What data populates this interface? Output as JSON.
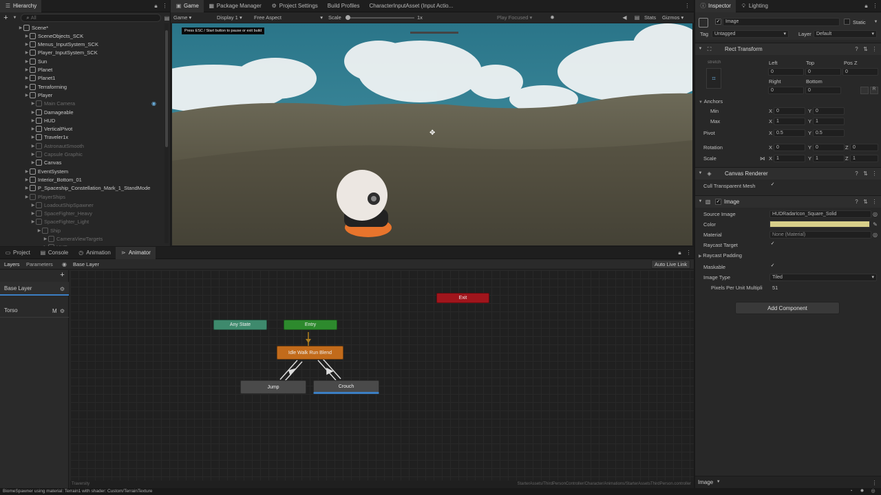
{
  "hierarchy": {
    "tab": "Hierarchy",
    "search_placeholder": "All",
    "items": [
      {
        "label": "Scene*",
        "indent": 0,
        "dim": false
      },
      {
        "label": "SceneObjects_SCK",
        "indent": 1,
        "dim": false
      },
      {
        "label": "Menus_InputSystem_SCK",
        "indent": 1,
        "dim": false
      },
      {
        "label": "Player_InputSystem_SCK",
        "indent": 1,
        "dim": false
      },
      {
        "label": "Sun",
        "indent": 1,
        "dim": false
      },
      {
        "label": "Planet",
        "indent": 1,
        "dim": false
      },
      {
        "label": "Planet1",
        "indent": 1,
        "dim": false
      },
      {
        "label": "Terraforming",
        "indent": 1,
        "dim": false
      },
      {
        "label": "Player",
        "indent": 1,
        "dim": false
      },
      {
        "label": "Main Camera",
        "indent": 2,
        "dim": true
      },
      {
        "label": "Damageable",
        "indent": 2,
        "dim": false
      },
      {
        "label": "HUD",
        "indent": 2,
        "dim": false
      },
      {
        "label": "VerticalPivot",
        "indent": 2,
        "dim": false
      },
      {
        "label": "Traveler1x",
        "indent": 2,
        "dim": false
      },
      {
        "label": "AstronautSmooth",
        "indent": 2,
        "dim": true
      },
      {
        "label": "Capsule Graphic",
        "indent": 2,
        "dim": true
      },
      {
        "label": "Canvas",
        "indent": 2,
        "dim": false
      },
      {
        "label": "EventSystem",
        "indent": 1,
        "dim": false
      },
      {
        "label": "Interior_Bottom_01",
        "indent": 1,
        "dim": false
      },
      {
        "label": "P_Spaceship_Constellation_Mark_1_StandMode",
        "indent": 1,
        "dim": false
      },
      {
        "label": "PlayerShips",
        "indent": 1,
        "dim": true
      },
      {
        "label": "LoadoutShipSpawner",
        "indent": 2,
        "dim": true
      },
      {
        "label": "SpaceFighter_Heavy",
        "indent": 2,
        "dim": true
      },
      {
        "label": "SpaceFighter_Light",
        "indent": 2,
        "dim": true
      },
      {
        "label": "Ship",
        "indent": 3,
        "dim": true
      },
      {
        "label": "CameraViewTargets",
        "indent": 4,
        "dim": true
      },
      {
        "label": "HUD",
        "indent": 4,
        "dim": true
      }
    ]
  },
  "top_tabs": {
    "game": "Game",
    "package_manager": "Package Manager",
    "project_settings": "Project Settings",
    "build_profiles": "Build Profiles",
    "input_asset": "CharacterInputAsset (Input Actio..."
  },
  "game_toolbar": {
    "game": "Game",
    "display": "Display 1",
    "aspect": "Free Aspect",
    "scale_label": "Scale",
    "scale_value": "1x",
    "play_focused": "Play Focused",
    "stats": "Stats",
    "gizmos": "Gizmos"
  },
  "game_view": {
    "overlay_text": "Press ESC / Start button to pause or exit build"
  },
  "bottom_tabs": {
    "project": "Project",
    "console": "Console",
    "animation": "Animation",
    "animator": "Animator"
  },
  "animator": {
    "layers_tab": "Layers",
    "parameters_tab": "Parameters",
    "breadcrumb": "Base Layer",
    "auto_live_link": "Auto Live Link",
    "layers": [
      {
        "name": "Base Layer",
        "suffix": ""
      },
      {
        "name": "Torso",
        "suffix": "M"
      }
    ],
    "nodes": {
      "exit": "Exit",
      "any_state": "Any State",
      "entry": "Entry",
      "default_state": "Idle Walk Run Blend",
      "jump": "Jump",
      "crouch": "Crouch"
    },
    "footer_left": "Traversity",
    "footer_path": "StarterAssets/ThirdPersonController/Character/Animations/StarterAssetsThirdPerson.controller"
  },
  "inspector": {
    "tab": "Inspector",
    "lighting_tab": "Lighting",
    "object_name": "Image",
    "static": "Static",
    "tag_label": "Tag",
    "tag_value": "Untagged",
    "layer_label": "Layer",
    "layer_value": "Default",
    "rect_transform": {
      "title": "Rect Transform",
      "stretch": "stretch",
      "left_label": "Left",
      "top_label": "Top",
      "posz_label": "Pos Z",
      "left": "0",
      "top": "0",
      "posz": "0",
      "right_label": "Right",
      "bottom_label": "Bottom",
      "right": "0",
      "bottom": "0",
      "anchors": "Anchors",
      "min": "Min",
      "max": "Max",
      "pivot": "Pivot",
      "rotation": "Rotation",
      "scale": "Scale",
      "min_x": "0",
      "min_y": "0",
      "max_x": "1",
      "max_y": "1",
      "pivot_x": "0.5",
      "pivot_y": "0.5",
      "rot_x": "0",
      "rot_y": "0",
      "rot_z": "0",
      "scale_x": "1",
      "scale_y": "1",
      "scale_z": "1"
    },
    "canvas_renderer": {
      "title": "Canvas Renderer",
      "cull_label": "Cull Transparent Mesh"
    },
    "image": {
      "title": "Image",
      "source_image_label": "Source Image",
      "source_image": "HUDRadarIcon_Square_Solid",
      "color_label": "Color",
      "color": "#d8cf8a",
      "material_label": "Material",
      "material": "None (Material)",
      "raycast_target": "Raycast Target",
      "raycast_padding": "Raycast Padding",
      "maskable": "Maskable",
      "image_type_label": "Image Type",
      "image_type": "Tiled",
      "ppu_label": "Pixels Per Unit Multipli",
      "ppu_value": "51"
    },
    "add_component": "Add Component",
    "footer": "Image"
  },
  "status_bar": {
    "text": "BiomeSpawner using material: Terrain1 with shader: Custom/TerrainTexture"
  }
}
